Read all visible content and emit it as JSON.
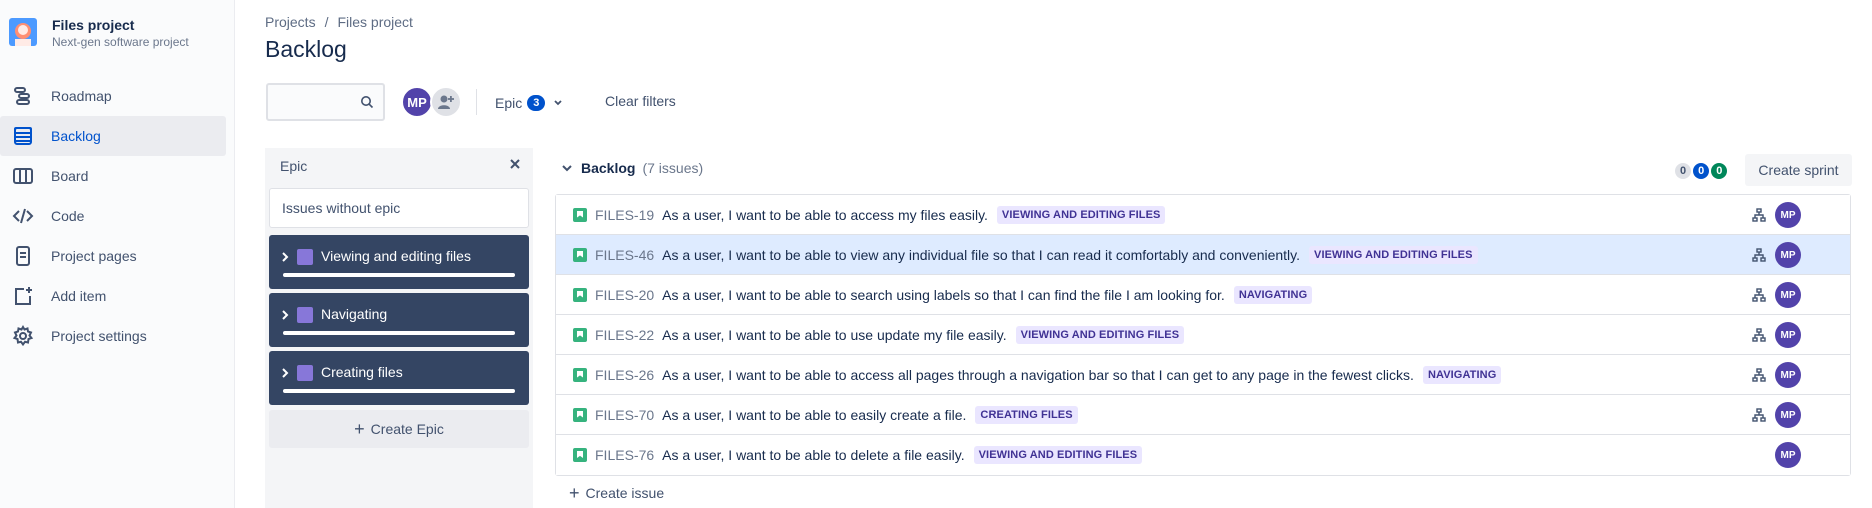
{
  "project": {
    "name": "Files project",
    "type": "Next-gen software project"
  },
  "nav": [
    {
      "label": "Roadmap",
      "icon": "roadmap-icon"
    },
    {
      "label": "Backlog",
      "icon": "backlog-icon",
      "active": true
    },
    {
      "label": "Board",
      "icon": "board-icon"
    },
    {
      "label": "Code",
      "icon": "code-icon"
    },
    {
      "label": "Project pages",
      "icon": "pages-icon"
    },
    {
      "label": "Add item",
      "icon": "add-item-icon"
    },
    {
      "label": "Project settings",
      "icon": "settings-icon"
    }
  ],
  "breadcrumbs": {
    "first": "Projects",
    "sep": "/",
    "second": "Files project"
  },
  "page_title": "Backlog",
  "search": {
    "placeholder": ""
  },
  "filters": {
    "avatar_initials": "MP",
    "epic_label": "Epic",
    "epic_count": "3",
    "clear_label": "Clear filters"
  },
  "epic_panel": {
    "title": "Epic",
    "no_epic_label": "Issues without epic",
    "epics": [
      {
        "name": "Viewing and editing files",
        "color": "#8777d9"
      },
      {
        "name": "Navigating",
        "color": "#8777d9"
      },
      {
        "name": "Creating files",
        "color": "#8777d9"
      }
    ],
    "create_label": "Create Epic"
  },
  "backlog": {
    "label": "Backlog",
    "count_label": "(7 issues)",
    "counts": {
      "todo": "0",
      "in_progress": "0",
      "done": "0"
    },
    "create_sprint_label": "Create sprint",
    "create_issue_label": "Create issue",
    "issues": [
      {
        "key": "FILES-19",
        "summary": "As a user, I want to be able to access my files easily.",
        "epic": "VIEWING AND EDITING FILES",
        "child": true,
        "assignee": "MP"
      },
      {
        "key": "FILES-46",
        "summary": "As a user, I want to be able to view any individual file so that I can read it comfortably and conveniently.",
        "epic": "VIEWING AND EDITING FILES",
        "child": true,
        "assignee": "MP",
        "selected": true
      },
      {
        "key": "FILES-20",
        "summary": "As a user, I want to be able to search using labels so that I can find the file I am looking for.",
        "epic": "NAVIGATING",
        "child": true,
        "assignee": "MP"
      },
      {
        "key": "FILES-22",
        "summary": "As a user, I want to be able to use update my file easily.",
        "epic": "VIEWING AND EDITING FILES",
        "child": true,
        "assignee": "MP"
      },
      {
        "key": "FILES-26",
        "summary": "As a user, I want to be able to access all pages through a navigation bar so that I can get to any page in the fewest clicks.",
        "epic": "NAVIGATING",
        "child": true,
        "assignee": "MP"
      },
      {
        "key": "FILES-70",
        "summary": "As a user, I want to be able to easily create a file.",
        "epic": "CREATING FILES",
        "child": true,
        "assignee": "MP"
      },
      {
        "key": "FILES-76",
        "summary": "As a user, I want to be able to delete a file easily.",
        "epic": "VIEWING AND EDITING FILES",
        "child": false,
        "assignee": "MP"
      }
    ]
  }
}
